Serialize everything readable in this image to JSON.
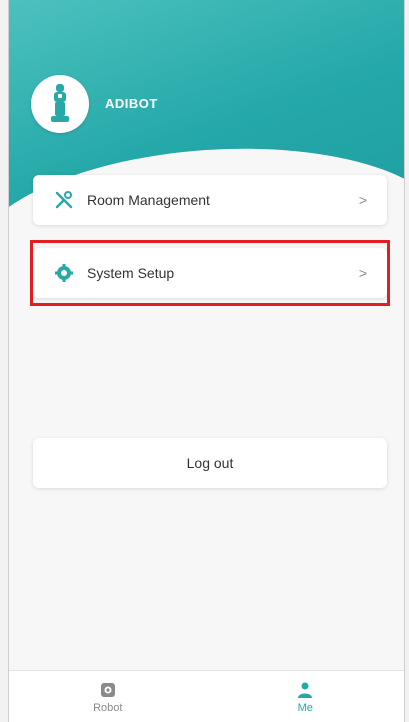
{
  "profile": {
    "username": "ADIBOT"
  },
  "menu": [
    {
      "label": "Room Management",
      "icon": "tools-icon",
      "chevron": ">"
    },
    {
      "label": "System Setup",
      "icon": "gear-icon",
      "chevron": ">"
    }
  ],
  "logout_label": "Log out",
  "tabbar": {
    "tabs": [
      {
        "label": "Robot",
        "icon": "robot-icon",
        "active": false
      },
      {
        "label": "Me",
        "icon": "person-icon",
        "active": true
      }
    ]
  },
  "colors": {
    "accent": "#25a8a9",
    "highlight": "#e02020",
    "inactive_tab": "#8a8a8a"
  }
}
